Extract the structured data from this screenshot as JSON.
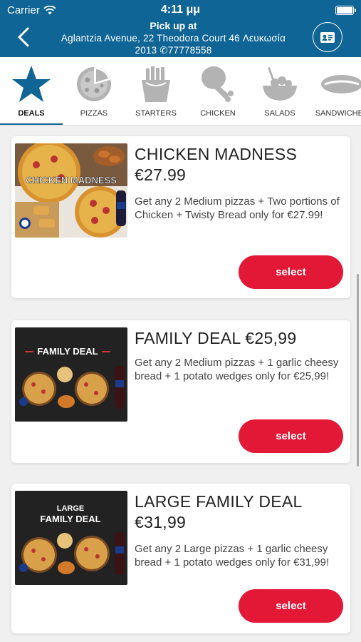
{
  "status": {
    "carrier": "Carrier",
    "time": "4:11 μμ",
    "battery_level": 1.0
  },
  "header": {
    "title": "Pick up at",
    "address_line1": "Aglantzia Avenue, 22 Theodora Court  46 Λευκωσία",
    "address_line2": "2013 ✆77778558",
    "back_icon": "chevron-left-icon",
    "contact_icon": "contact-card-icon",
    "color": "#0f6596"
  },
  "categories": [
    {
      "label": "DEALS",
      "icon": "star-icon",
      "active": true
    },
    {
      "label": "PIZZAS",
      "icon": "pizza-icon",
      "active": false
    },
    {
      "label": "STARTERS",
      "icon": "fries-icon",
      "active": false
    },
    {
      "label": "CHICKEN",
      "icon": "drumstick-icon",
      "active": false
    },
    {
      "label": "SALADS",
      "icon": "salad-bowl-icon",
      "active": false
    },
    {
      "label": "SANDWICHES",
      "icon": "sandwich-icon",
      "active": false
    }
  ],
  "deals": [
    {
      "image_text": "CHICKEN MADNESS",
      "title": "CHICKEN MADNESS €27.99",
      "description": "Get any 2 Medium pizzas + Two portions of Chicken + Twisty Bread only for €27.99!",
      "button": "select"
    },
    {
      "image_text": "FAMILY DEAL",
      "title": "FAMILY DEAL €25,99",
      "description": "Get any 2 Medium pizzas + 1 garlic cheesy bread + 1 potato wedges only for €25,99!",
      "button": "select"
    },
    {
      "image_text_top": "LARGE",
      "image_text": "FAMILY DEAL",
      "title": "LARGE FAMILY DEAL €31,99",
      "description": "Get any 2 Large pizzas + 1 garlic cheesy bread + 1 potato wedges only for €31,99!",
      "button": "select"
    }
  ],
  "colors": {
    "accent": "#e31837",
    "brand": "#0f6596"
  }
}
